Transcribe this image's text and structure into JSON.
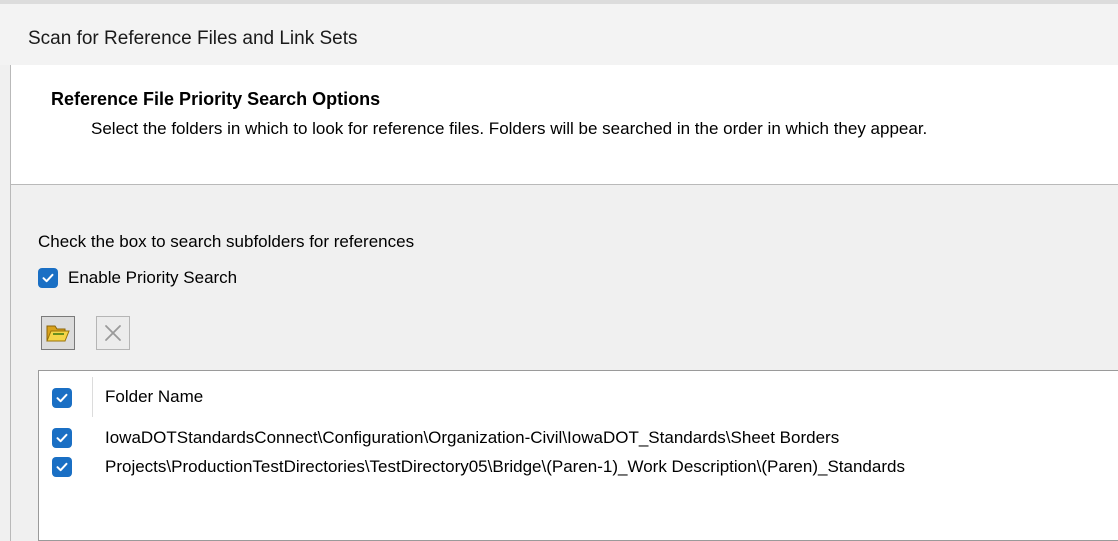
{
  "window": {
    "title": "Scan for Reference Files and Link Sets"
  },
  "header": {
    "title": "Reference File Priority Search Options",
    "description": "Select the folders in which to look for reference files.  Folders will be searched in the order in which they appear."
  },
  "options": {
    "instruction": "Check the box to search subfolders for references",
    "enable_priority_search": {
      "label": "Enable Priority Search",
      "checked": true
    }
  },
  "toolbar": {
    "add_folder_icon": "folder-icon",
    "remove_icon": "close-icon"
  },
  "folder_list": {
    "header": {
      "label": "Folder Name",
      "checked": true
    },
    "rows": [
      {
        "path": "IowaDOTStandardsConnect\\Configuration\\Organization-Civil\\IowaDOT_Standards\\Sheet Borders",
        "checked": true
      },
      {
        "path": "Projects\\ProductionTestDirectories\\TestDirectory05\\Bridge\\(Paren-1)_Work Description\\(Paren)_Standards",
        "checked": true
      }
    ]
  },
  "colors": {
    "accent": "#1a6fc4",
    "background": "#f0f0f0",
    "header_bg": "#ffffff"
  }
}
